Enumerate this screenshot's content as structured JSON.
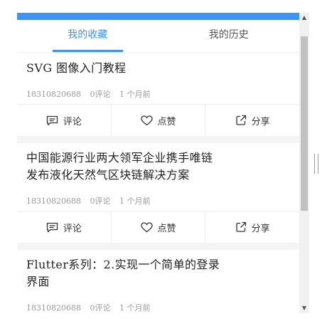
{
  "tabs": [
    {
      "label": "我的收藏"
    },
    {
      "label": "我的历史"
    }
  ],
  "articles": [
    {
      "title_lines": [
        "SVG 图像入门教程"
      ],
      "user": "18310820688",
      "comments": "0评论",
      "time": "1 个月前"
    },
    {
      "title_lines": [
        "中国能源行业两大领军企业携手唯链",
        "发布液化天然气区块链解决方案"
      ],
      "user": "18310820688",
      "comments": "0评论",
      "time": "1 个月前"
    },
    {
      "title_lines": [
        "Flutter系列：2.实现一个简单的登录",
        "界面"
      ],
      "user": "18310820688",
      "comments": "0评论",
      "time": "1 个月前"
    }
  ],
  "actions": {
    "comment": "评论",
    "like": "点赞",
    "share": "分享"
  },
  "scrollbar": {
    "up_arrow": "▲",
    "down_arrow": "▼"
  },
  "colors": {
    "accent": "#3d94f2",
    "text": "#222222",
    "meta": "#999999"
  },
  "icons": {
    "comment": "comment-icon",
    "like": "heart-icon",
    "share": "share-icon"
  }
}
